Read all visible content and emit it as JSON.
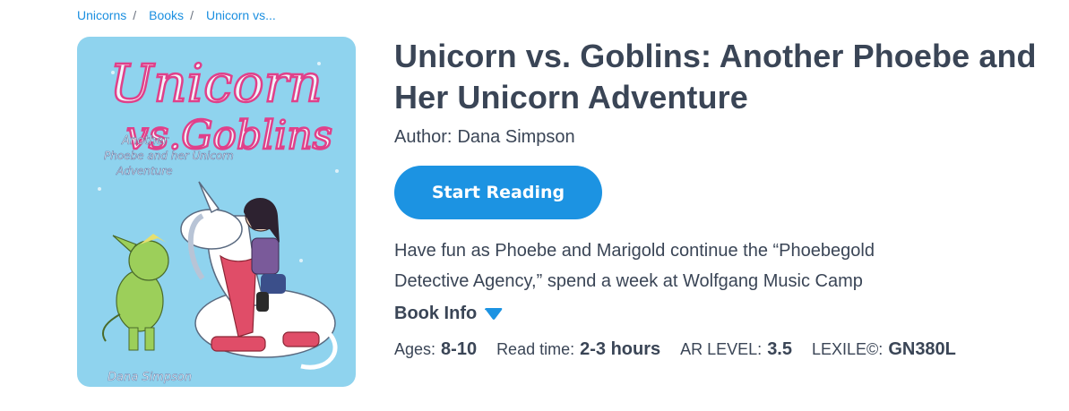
{
  "breadcrumb": [
    {
      "label": "Unicorns"
    },
    {
      "label": "Books"
    },
    {
      "label": "Unicorn vs..."
    }
  ],
  "cover": {
    "title_line1": "Unicorn",
    "title_line2": "vs.Goblins",
    "subtitle": [
      "Another",
      "Phoebe and her Unicorn",
      "Adventure"
    ],
    "author": "Dana Simpson",
    "colors": {
      "background": "#8fd3ee",
      "title": "#f2f6fb",
      "title_outline": "#e0408a"
    }
  },
  "book": {
    "title": "Unicorn vs. Goblins: Another Phoebe and Her Unicorn Adventure",
    "author_label": "Author:",
    "author": "Dana Simpson",
    "start_label": "Start Reading",
    "description": "Have fun as Phoebe and Marigold continue the “Phoebegold Detective Agency,” spend a week at Wolfgang Music Camp",
    "book_info_label": "Book Info"
  },
  "stats": [
    {
      "label": "Ages:",
      "value": "8-10"
    },
    {
      "label": "Read time:",
      "value": "2-3 hours"
    },
    {
      "label": "AR LEVEL:",
      "value": "3.5"
    },
    {
      "label": "LEXILE©:",
      "value": "GN380L"
    }
  ],
  "colors": {
    "accent": "#1c93e2",
    "text": "#3a4556",
    "link": "#1b8fe0"
  }
}
